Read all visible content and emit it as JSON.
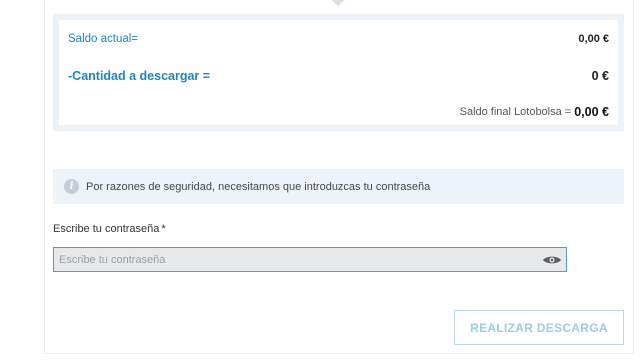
{
  "summary": {
    "current_balance_label": "Saldo actual=",
    "current_balance_value": "0,00 €",
    "withdraw_amount_label": "-Cantidad a descargar =",
    "withdraw_amount_value": "0 €",
    "final_balance_label": "Saldo final Lotobolsa =",
    "final_balance_value": "0,00 €"
  },
  "security_notice": {
    "icon": "info-icon",
    "text": "Por razones de seguridad, necesitamos que introduzcas tu contraseña"
  },
  "password": {
    "label": "Escribe tu contraseña",
    "required_mark": "*",
    "placeholder": "Escribe tu contraseña",
    "value": "",
    "toggle_icon": "eye-icon"
  },
  "actions": {
    "submit_label": "REALIZAR DESCARGA"
  },
  "colors": {
    "accent_blue": "#1a86c7",
    "panel_bg": "#edf2f6",
    "input_border": "#5a98c7",
    "button_text": "#9fcbe6"
  }
}
